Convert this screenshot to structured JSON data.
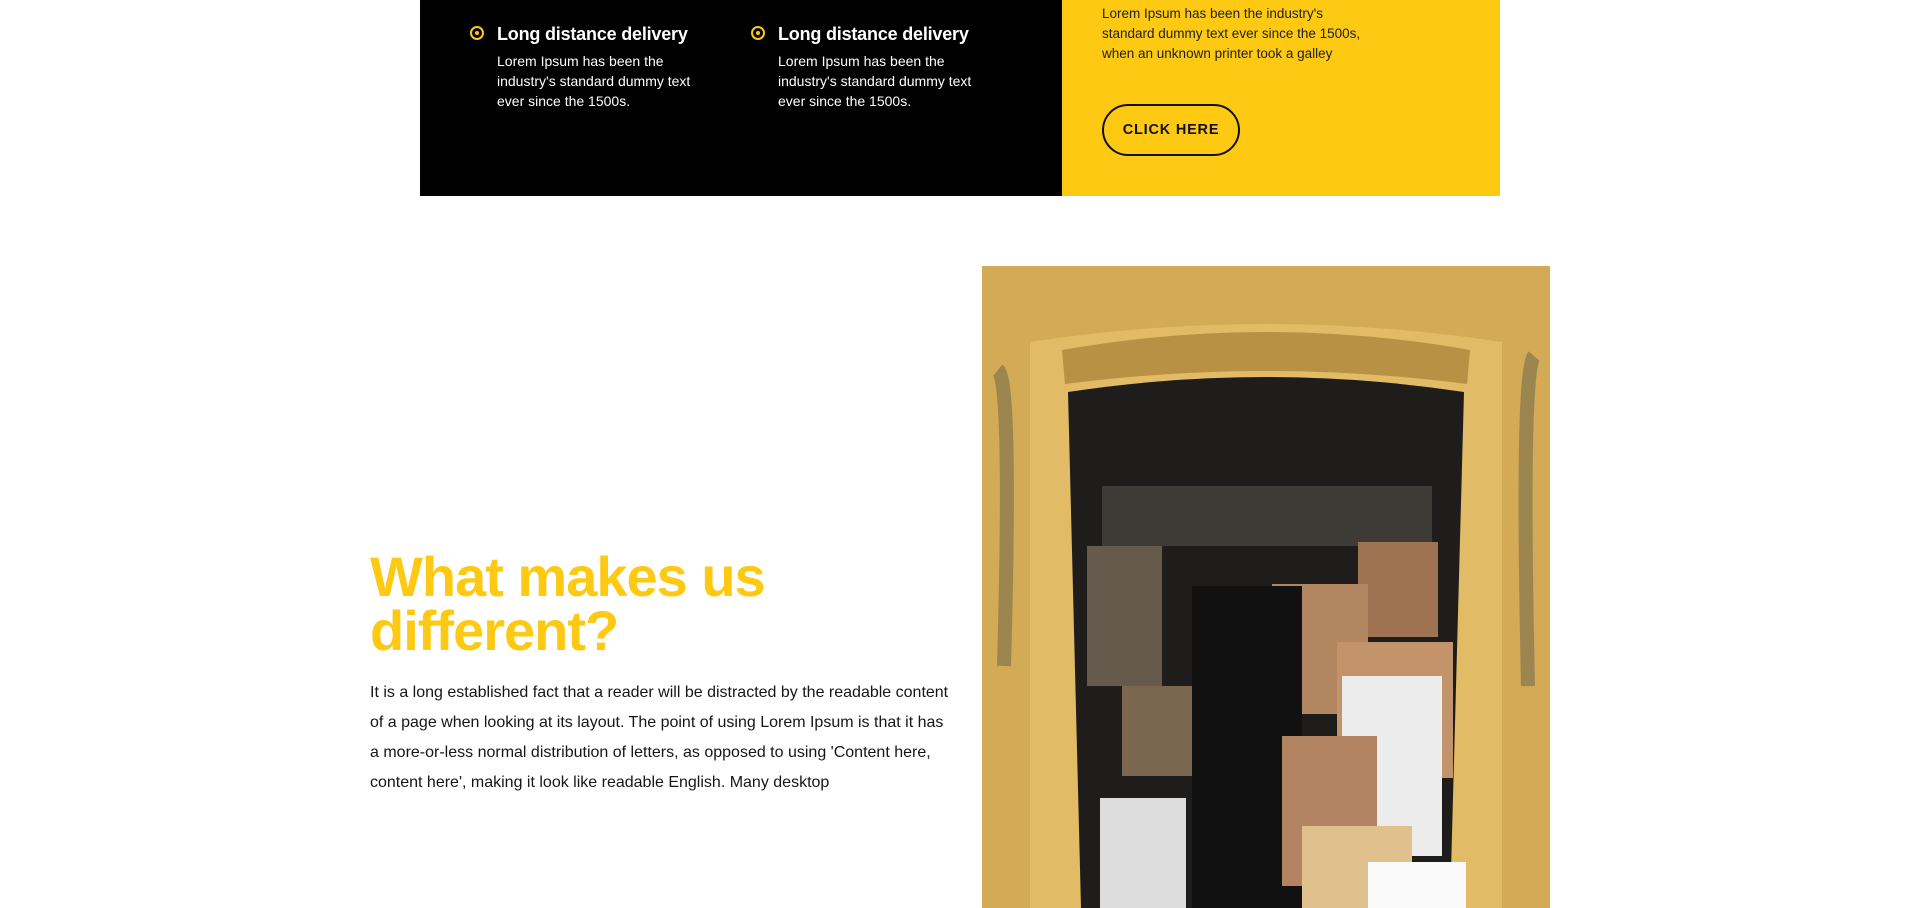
{
  "delivery_features": [
    {
      "title": "Long distance delivery",
      "text": "Lorem Ipsum has been the industry's standard dummy text ever since the 1500s."
    },
    {
      "title": "Long distance delivery",
      "text": "Lorem Ipsum has been the industry's standard dummy text ever since the 1500s."
    }
  ],
  "promo": {
    "text": "Lorem Ipsum has been the industry's standard dummy text ever since the 1500s, when an unknown printer took a galley",
    "button_label": "CLICK HERE"
  },
  "about": {
    "heading": "What makes us different?",
    "body": "It is a long established fact that a reader will be distracted by the readable content of a page when looking at its layout. The point of using Lorem Ipsum is that it has a more-or-less normal distribution of letters, as opposed to using 'Content here, content here', making it look like readable English. Many desktop"
  },
  "colors": {
    "accent": "#fdc912",
    "panel": "#000000",
    "text": "#161616"
  }
}
